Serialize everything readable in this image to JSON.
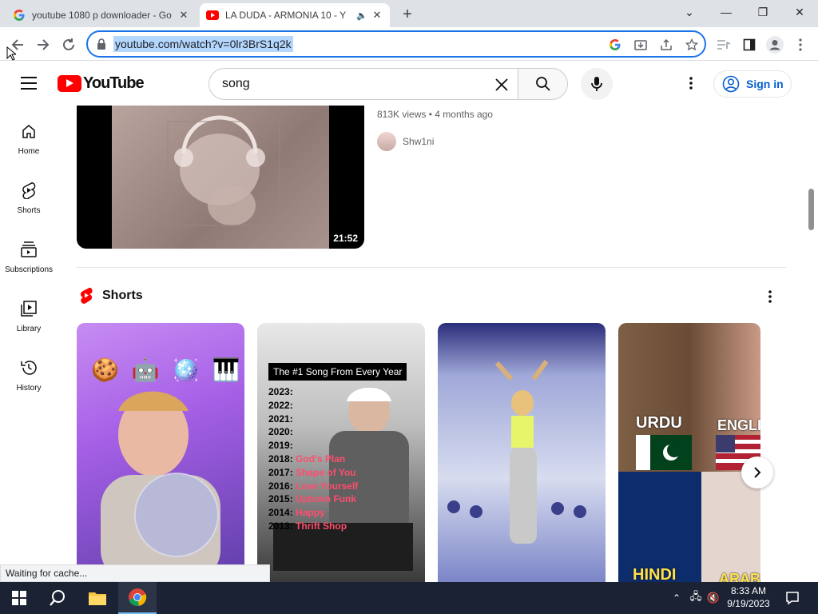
{
  "browser": {
    "tabs": [
      {
        "title": "youtube 1080 p downloader - Go",
        "favicon": "google-icon",
        "active": false
      },
      {
        "title": "LA DUDA - ARMONIA 10 - Y",
        "favicon": "youtube-icon",
        "active": true
      }
    ],
    "url": "youtube.com/watch?v=0lr3BrS1q2k",
    "status_text": "Waiting for cache..."
  },
  "youtube": {
    "logo_text": "YouTube",
    "search_value": "song",
    "signin_label": "Sign in",
    "sidebar": [
      {
        "label": "Home",
        "icon": "home-icon"
      },
      {
        "label": "Shorts",
        "icon": "shorts-icon"
      },
      {
        "label": "Subscriptions",
        "icon": "subscriptions-icon"
      },
      {
        "label": "Library",
        "icon": "library-icon"
      },
      {
        "label": "History",
        "icon": "history-icon"
      }
    ],
    "video": {
      "duration": "21:52",
      "views": "813K views",
      "age": "4 months ago",
      "channel": "Shw1ni"
    },
    "shorts": {
      "section_title": "Shorts",
      "items": [
        {
          "emojis": "🍪 🤖 🪩 🎹"
        },
        {
          "overlay_title": "The #1 Song From Every Year",
          "years": [
            {
              "year": "2023:",
              "song": ""
            },
            {
              "year": "2022:",
              "song": ""
            },
            {
              "year": "2021:",
              "song": ""
            },
            {
              "year": "2020:",
              "song": ""
            },
            {
              "year": "2019:",
              "song": ""
            },
            {
              "year": "2018:",
              "song": "God's Plan"
            },
            {
              "year": "2017:",
              "song": "Shape of You"
            },
            {
              "year": "2016:",
              "song": "Love Yourself"
            },
            {
              "year": "2015:",
              "song": "Uptown Funk"
            },
            {
              "year": "2014:",
              "song": "Happy"
            },
            {
              "year": "2013:",
              "song": "Thrift Shop"
            }
          ]
        },
        {
          "label": ""
        },
        {
          "labels": [
            "URDU",
            "ENGLIS",
            "HINDI",
            "ARAB"
          ]
        }
      ]
    }
  },
  "taskbar": {
    "time": "8:33 AM",
    "date": "9/19/2023"
  },
  "colors": {
    "youtube_red": "#ff0000",
    "link_blue": "#065fd4",
    "omnibox_focus": "#1a73e8",
    "taskbar_bg": "#1b2233"
  }
}
